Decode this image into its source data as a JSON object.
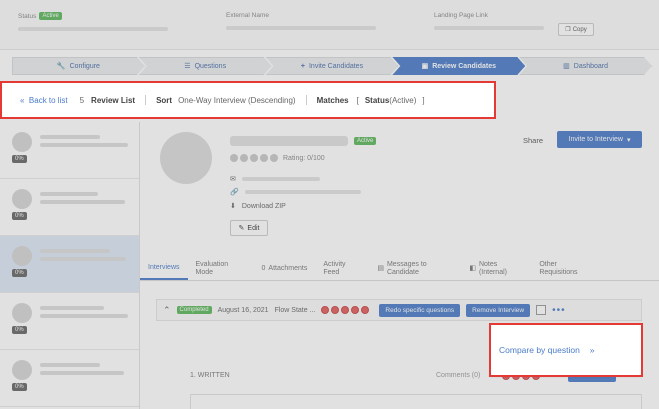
{
  "header": {
    "status_label": "Status",
    "status_value": "Active",
    "external_name_label": "External Name",
    "landing_page_label": "Landing Page Link",
    "copy_label": "Copy"
  },
  "steps": [
    {
      "label": "Configure",
      "icon": "wrench-icon"
    },
    {
      "label": "Questions",
      "icon": "list-icon"
    },
    {
      "label": "Invite Candidates",
      "icon": "plus-icon"
    },
    {
      "label": "Review Candidates",
      "icon": "review-icon",
      "active": true
    },
    {
      "label": "Dashboard",
      "icon": "bar-chart-icon"
    }
  ],
  "context": {
    "back_label": "Back to list",
    "count": "5",
    "review_list_label": "Review List",
    "sort_label": "Sort",
    "sort_value": "One-Way Interview (Descending)",
    "matches_label": "Matches",
    "bracket_open": "[",
    "status_label": "Status",
    "status_value": "(Active)",
    "bracket_close": "]"
  },
  "list": {
    "items": [
      {
        "pct": "0%",
        "selected": false
      },
      {
        "pct": "0%",
        "selected": false
      },
      {
        "pct": "0%",
        "selected": true
      },
      {
        "pct": "0%",
        "selected": false
      },
      {
        "pct": "0%",
        "selected": false
      }
    ]
  },
  "profile": {
    "active_badge": "Active",
    "rating_text": "Rating: 0/100",
    "download_label": "Download ZIP",
    "edit_label": "Edit",
    "share_label": "Share",
    "invite_label": "Invite to Interview"
  },
  "tabs": [
    {
      "label": "Interviews",
      "active": true
    },
    {
      "label": "Evaluation Mode"
    },
    {
      "label": "Attachments",
      "count": "0"
    },
    {
      "label": "Activity Feed"
    },
    {
      "label": "Messages to Candidate"
    },
    {
      "label": "Notes (Internal)"
    },
    {
      "label": "Other Requisitions"
    }
  ],
  "interview": {
    "status_badge": "Completed",
    "date": "August 16, 2021",
    "name": "Flow State ...",
    "redo_label": "Redo specific questions",
    "remove_label": "Remove Interview",
    "more_glyph": "•••"
  },
  "compare": {
    "label": "Compare by question",
    "chevron": "»"
  },
  "written": {
    "label": "1. WRITTEN",
    "comments": "Comments (0)",
    "review_label": "Review"
  },
  "colors": {
    "accent": "#4a7cc9",
    "success": "#5cb85c",
    "highlight": "#e53935",
    "rating_dot": "#e35d5d"
  }
}
